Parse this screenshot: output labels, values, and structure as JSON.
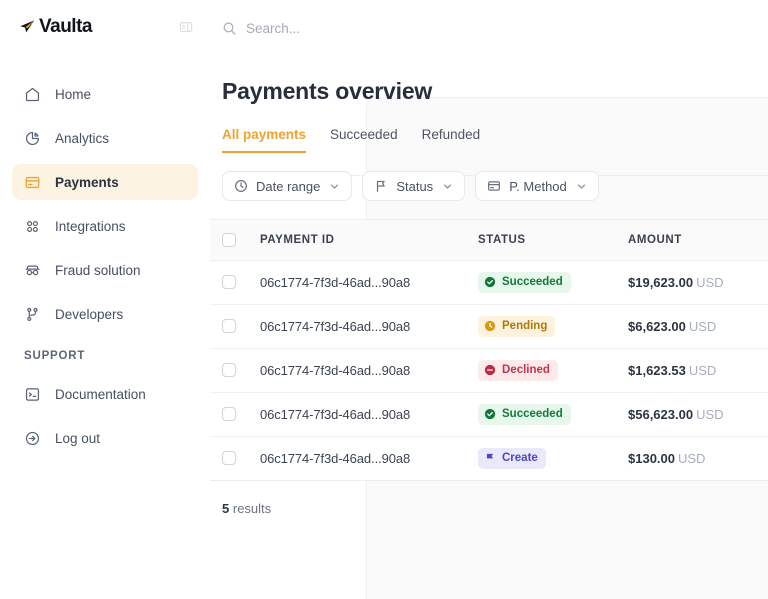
{
  "brand": {
    "name": "Vaulta",
    "logo_icon": "paper-plane-icon",
    "accent": "#eca32e",
    "collapse_icon": "sidebar-collapse-icon"
  },
  "sidebar": {
    "items": [
      {
        "label": "Home",
        "icon": "home-icon",
        "active": false
      },
      {
        "label": "Analytics",
        "icon": "pie-chart-icon",
        "active": false
      },
      {
        "label": "Payments",
        "icon": "card-icon",
        "active": true
      },
      {
        "label": "Integrations",
        "icon": "grid-dots-icon",
        "active": false
      },
      {
        "label": "Fraud solution",
        "icon": "spy-glasses-icon",
        "active": false
      },
      {
        "label": "Developers",
        "icon": "git-branch-icon",
        "active": false
      }
    ],
    "section_label": "SUPPORT",
    "support_items": [
      {
        "label": "Documentation",
        "icon": "terminal-icon"
      },
      {
        "label": "Log out",
        "icon": "logout-icon"
      }
    ]
  },
  "search": {
    "placeholder": "Search...",
    "value": "",
    "icon": "search-icon"
  },
  "header": {
    "title": "Payments overview"
  },
  "tabs": [
    {
      "label": "All payments",
      "active": true
    },
    {
      "label": "Succeeded",
      "active": false
    },
    {
      "label": "Refunded",
      "active": false
    }
  ],
  "filters": [
    {
      "label": "Date range",
      "icon": "clock-icon",
      "caret": "chevron-down-icon"
    },
    {
      "label": "Status",
      "icon": "flag-icon",
      "caret": "chevron-down-icon"
    },
    {
      "label": "P. Method",
      "icon": "card-icon",
      "caret": "chevron-down-icon"
    }
  ],
  "table": {
    "columns": [
      "PAYMENT ID",
      "STATUS",
      "AMOUNT"
    ],
    "rows": [
      {
        "id": "06c1774-7f3d-46ad...90a8",
        "status": "Succeeded",
        "status_kind": "succeeded",
        "status_icon": "check-circle-icon",
        "amount": "$19,623.00",
        "currency": "USD"
      },
      {
        "id": "06c1774-7f3d-46ad...90a8",
        "status": "Pending",
        "status_kind": "pending",
        "status_icon": "clock-circle-icon",
        "amount": "$6,623.00",
        "currency": "USD"
      },
      {
        "id": "06c1774-7f3d-46ad...90a8",
        "status": "Declined",
        "status_kind": "declined",
        "status_icon": "minus-circle-icon",
        "amount": "$1,623.53",
        "currency": "USD"
      },
      {
        "id": "06c1774-7f3d-46ad...90a8",
        "status": "Succeeded",
        "status_kind": "succeeded",
        "status_icon": "check-circle-icon",
        "amount": "$56,623.00",
        "currency": "USD"
      },
      {
        "id": "06c1774-7f3d-46ad...90a8",
        "status": "Create",
        "status_kind": "create",
        "status_icon": "flag-icon",
        "amount": "$130.00",
        "currency": "USD"
      }
    ]
  },
  "footer": {
    "count": "5",
    "results_label": "results"
  },
  "colors": {
    "accent": "#f0a330",
    "succeeded_bg": "#e7f7ec",
    "succeeded_fg": "#117a38",
    "pending_bg": "#fdf2de",
    "pending_fg": "#b07808",
    "declined_bg": "#fdeaea",
    "declined_fg": "#c6344a",
    "create_bg": "#e9e9fb",
    "create_fg": "#4a46c9"
  }
}
